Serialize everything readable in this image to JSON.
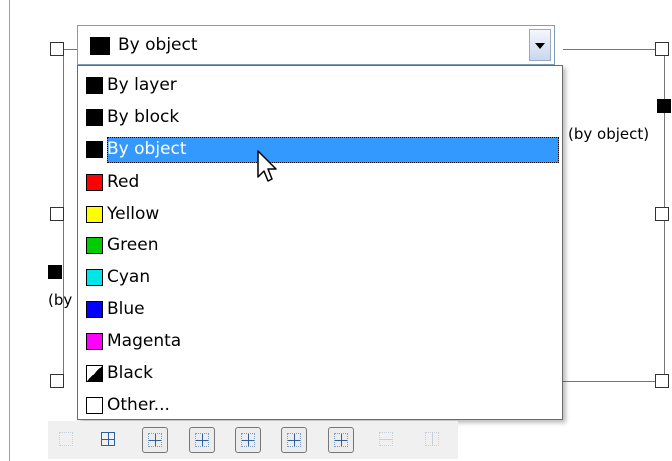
{
  "combo": {
    "selected_label": "By object",
    "selected_swatch": "#000000"
  },
  "dropdown": {
    "items": [
      {
        "label": "By layer",
        "swatch": "#000000",
        "style": "solid"
      },
      {
        "label": "By block",
        "swatch": "#000000",
        "style": "solid"
      },
      {
        "label": "By object",
        "swatch": "#000000",
        "style": "solid"
      },
      {
        "label": "Red",
        "swatch": "#ff0000",
        "style": "solid"
      },
      {
        "label": "Yellow",
        "swatch": "#ffff00",
        "style": "solid"
      },
      {
        "label": "Green",
        "swatch": "#00cc00",
        "style": "solid"
      },
      {
        "label": "Cyan",
        "swatch": "#00e5e5",
        "style": "solid"
      },
      {
        "label": "Blue",
        "swatch": "#0000ff",
        "style": "solid"
      },
      {
        "label": "Magenta",
        "swatch": "#ff00ff",
        "style": "solid"
      },
      {
        "label": "Black",
        "swatch": "#000000",
        "style": "half"
      },
      {
        "label": "Other...",
        "swatch": "#ffffff",
        "style": "empty"
      }
    ],
    "highlighted_index": 2,
    "highlight_color": "#3399ff"
  },
  "preview": {
    "right_label": "(by object)",
    "left_label": "(by"
  },
  "toolbar": {
    "icons": [
      "grid-none-icon",
      "grid-inside-icon",
      "grid-all-icon",
      "grid-outer-icon",
      "grid-top-icon",
      "grid-bottom-icon",
      "grid-left-icon",
      "grid-horizontal-icon",
      "grid-vertical-icon"
    ]
  }
}
